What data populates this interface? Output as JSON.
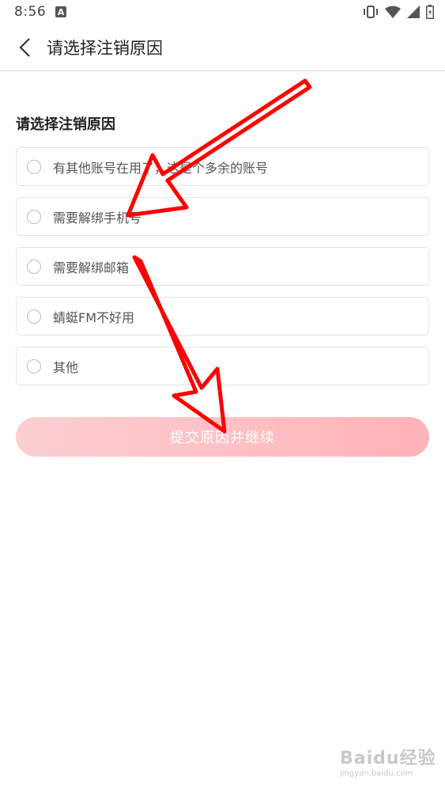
{
  "status_bar": {
    "time": "8:56",
    "notification_icon": "a-icon",
    "icons": [
      "vibrate-icon",
      "wifi-icon",
      "signal-icon",
      "battery-icon"
    ]
  },
  "header": {
    "title": "请选择注销原因"
  },
  "main": {
    "section_title": "请选择注销原因",
    "options": [
      {
        "label": "有其他账号在用了，这是个多余的账号"
      },
      {
        "label": "需要解绑手机号"
      },
      {
        "label": "需要解绑邮箱"
      },
      {
        "label": "蜻蜓FM不好用"
      },
      {
        "label": "其他"
      }
    ],
    "submit_label": "提交原因并继续"
  },
  "watermark": {
    "logo_text": "Baidu经验",
    "url": "jingyan.baidu.com"
  },
  "colors": {
    "annotation_arrow": "#ff0000",
    "button_start": "#fccfd2",
    "button_end": "#ffb3b8",
    "divider": "#d9d9d9"
  }
}
